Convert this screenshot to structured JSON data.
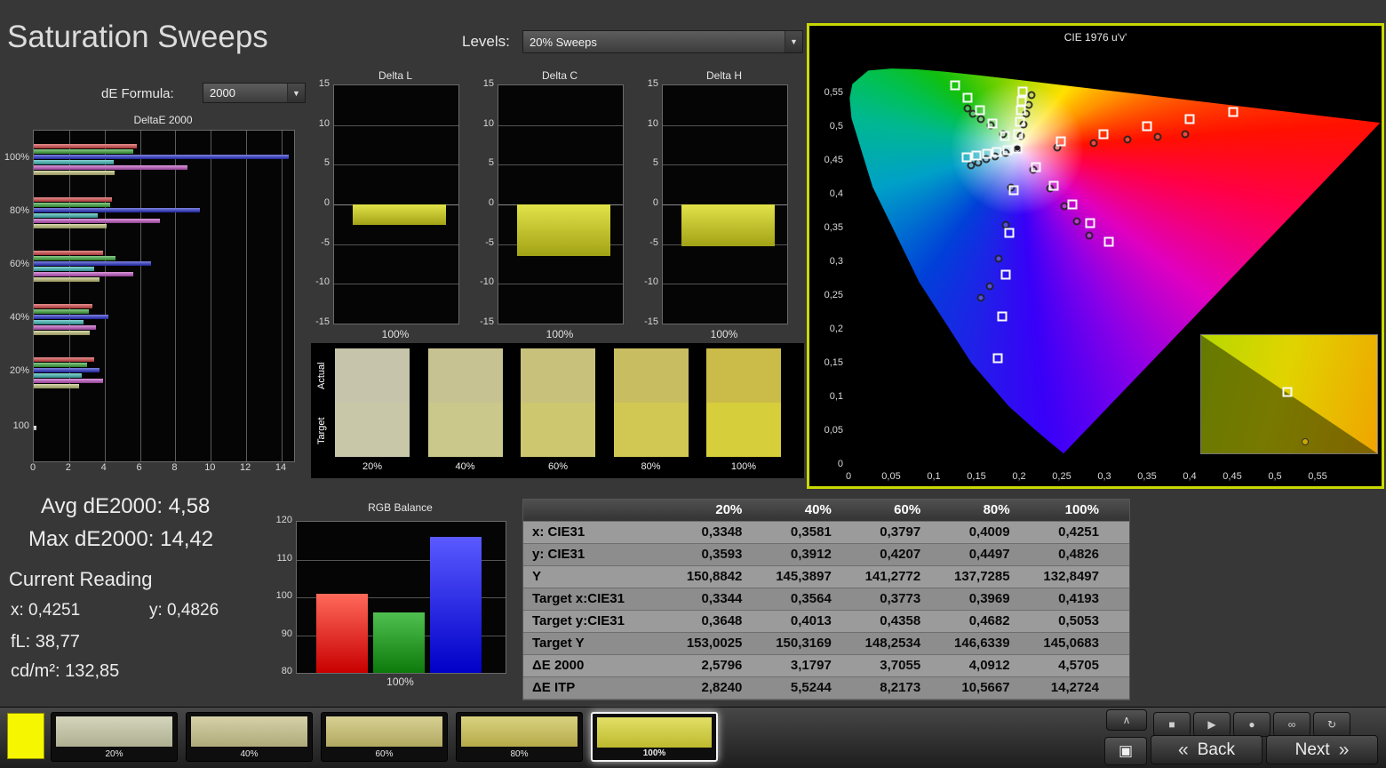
{
  "page": {
    "title": "Saturation Sweeps",
    "de_formula_label": "dE Formula:",
    "de_formula_value": "2000",
    "levels_label": "Levels:",
    "levels_value": "20% Sweeps"
  },
  "icons": {
    "dropdown_arrow": "▼"
  },
  "readings": {
    "avg": "Avg dE2000: 4,58",
    "max": "Max dE2000: 14,42",
    "current_title": "Current Reading",
    "x": "x: 0,4251",
    "y": "y: 0,4826",
    "fl": "fL: 38,77",
    "cdm2": "cd/m²: 132,85"
  },
  "table": {
    "columns": [
      "20%",
      "40%",
      "60%",
      "80%",
      "100%"
    ],
    "rows": [
      {
        "label": "x: CIE31",
        "values": [
          "0,3348",
          "0,3581",
          "0,3797",
          "0,4009",
          "0,4251"
        ]
      },
      {
        "label": "y: CIE31",
        "values": [
          "0,3593",
          "0,3912",
          "0,4207",
          "0,4497",
          "0,4826"
        ]
      },
      {
        "label": "Y",
        "values": [
          "150,8842",
          "145,3897",
          "141,2772",
          "137,7285",
          "132,8497"
        ]
      },
      {
        "label": "Target x:CIE31",
        "values": [
          "0,3344",
          "0,3564",
          "0,3773",
          "0,3969",
          "0,4193"
        ]
      },
      {
        "label": "Target y:CIE31",
        "values": [
          "0,3648",
          "0,4013",
          "0,4358",
          "0,4682",
          "0,5053"
        ]
      },
      {
        "label": "Target Y",
        "values": [
          "153,0025",
          "150,3169",
          "148,2534",
          "146,6339",
          "145,0683"
        ]
      },
      {
        "label": "ΔE 2000",
        "values": [
          "2,5796",
          "3,1797",
          "3,7055",
          "4,0912",
          "4,5705"
        ]
      },
      {
        "label": "ΔE ITP",
        "values": [
          "2,8240",
          "5,5244",
          "8,2173",
          "10,5667",
          "14,2724"
        ]
      }
    ]
  },
  "swatch_panel": {
    "row_labels": [
      "Actual",
      "Target"
    ],
    "levels": [
      "20%",
      "40%",
      "60%",
      "80%",
      "100%"
    ],
    "actual_colors": [
      "#c6c5ab",
      "#c7c292",
      "#c8c17b",
      "#c9bd62",
      "#cbbc4a"
    ],
    "target_colors": [
      "#c8c7a8",
      "#cac88b",
      "#cdc76f",
      "#d0c853",
      "#d6ce3a"
    ]
  },
  "toolbar": {
    "selected_color": "#f6f600",
    "levels": [
      {
        "label": "20%",
        "color": "#c7c7a6",
        "selected": false
      },
      {
        "label": "40%",
        "color": "#c8c28a",
        "selected": false
      },
      {
        "label": "60%",
        "color": "#cac06e",
        "selected": false
      },
      {
        "label": "80%",
        "color": "#cdc254",
        "selected": false
      },
      {
        "label": "100%",
        "color": "#d8d434",
        "selected": true
      }
    ],
    "controls": {
      "collapse_glyph": "∧",
      "buttons": [
        {
          "name": "stop",
          "glyph": "■"
        },
        {
          "name": "play",
          "glyph": "▶"
        },
        {
          "name": "record",
          "glyph": "●"
        },
        {
          "name": "continuous",
          "glyph": "∞"
        },
        {
          "name": "refresh",
          "glyph": "↻"
        }
      ],
      "stop_large_glyph": "▣",
      "back": {
        "chevron": "«",
        "label": "Back"
      },
      "next": {
        "label": "Next",
        "chevron": "»"
      }
    }
  },
  "chart_data": [
    {
      "id": "deltae_2000_bars",
      "type": "bar",
      "orientation": "horizontal",
      "title": "DeltaE 2000",
      "groups": [
        "100%",
        "80%",
        "60%",
        "40%",
        "20%",
        "100"
      ],
      "series": [
        {
          "name": "Red",
          "color": "#d84545",
          "values": [
            5.8,
            4.4,
            3.9,
            3.3,
            3.4,
            null
          ]
        },
        {
          "name": "Green",
          "color": "#3aa83a",
          "values": [
            5.6,
            4.3,
            4.6,
            3.1,
            3.0,
            null
          ]
        },
        {
          "name": "Blue",
          "color": "#2830cc",
          "values": [
            14.42,
            9.4,
            6.6,
            4.2,
            3.7,
            null
          ]
        },
        {
          "name": "Cyan",
          "color": "#3ab8b8",
          "values": [
            4.5,
            3.6,
            3.4,
            2.8,
            2.7,
            null
          ]
        },
        {
          "name": "Magenta",
          "color": "#c455c4",
          "values": [
            8.7,
            7.1,
            5.6,
            3.5,
            3.9,
            null
          ]
        },
        {
          "name": "Yellow",
          "color": "#c2c27a",
          "values": [
            4.57,
            4.09,
            3.71,
            3.18,
            2.58,
            null
          ]
        },
        {
          "name": "White",
          "color": "#e8e8e8",
          "values": [
            null,
            null,
            null,
            null,
            null,
            0.15
          ]
        }
      ],
      "xlim": [
        0,
        14.7
      ],
      "xticks": [
        0,
        2,
        4,
        6,
        8,
        10,
        12,
        14
      ]
    },
    {
      "id": "delta_l",
      "type": "bar",
      "title": "Delta L",
      "categories": [
        "100%"
      ],
      "values": [
        -2.6
      ],
      "ylim": [
        -15,
        15
      ],
      "yticks": [
        15,
        10,
        5,
        0,
        -5,
        -10,
        -15
      ],
      "bar_color": "#d6d62e"
    },
    {
      "id": "delta_c",
      "type": "bar",
      "title": "Delta C",
      "categories": [
        "100%"
      ],
      "values": [
        -6.5
      ],
      "ylim": [
        -15,
        15
      ],
      "yticks": [
        15,
        10,
        5,
        0,
        -5,
        -10,
        -15
      ],
      "bar_color": "#d6d62e"
    },
    {
      "id": "delta_h",
      "type": "bar",
      "title": "Delta H",
      "categories": [
        "100%"
      ],
      "values": [
        -5.3
      ],
      "ylim": [
        -15,
        15
      ],
      "yticks": [
        15,
        10,
        5,
        0,
        -5,
        -10,
        -15
      ],
      "bar_color": "#d6d62e"
    },
    {
      "id": "rgb_balance",
      "type": "bar",
      "title": "RGB Balance",
      "categories": [
        "Red",
        "Green",
        "Blue"
      ],
      "values": [
        101,
        96,
        116
      ],
      "colors": [
        "#e00000",
        "#18a018",
        "#2020e8"
      ],
      "ylim": [
        80,
        120
      ],
      "yticks": [
        120,
        110,
        100,
        90,
        80
      ],
      "xlabel": "100%"
    },
    {
      "id": "cie_1976_uv",
      "type": "scatter",
      "title": "CIE 1976 u'v'",
      "xlim": [
        0,
        0.6
      ],
      "ylim": [
        0,
        0.6
      ],
      "ticks": [
        0,
        0.05,
        0.1,
        0.15,
        0.2,
        0.25,
        0.3,
        0.35,
        0.4,
        0.45,
        0.5,
        0.55
      ],
      "white_point": [
        0.1978,
        0.4683
      ],
      "locus": [
        [
          0.6234,
          0.5065
        ],
        [
          0.5203,
          0.5219
        ],
        [
          0.4035,
          0.5393
        ],
        [
          0.3315,
          0.5501
        ],
        [
          0.2623,
          0.5604
        ],
        [
          0.2026,
          0.5693
        ],
        [
          0.1531,
          0.5766
        ],
        [
          0.1127,
          0.5821
        ],
        [
          0.0792,
          0.5856
        ],
        [
          0.0501,
          0.5867
        ],
        [
          0.0231,
          0.5837
        ],
        [
          0.0046,
          0.5638
        ],
        [
          0.0014,
          0.5432
        ],
        [
          0.0035,
          0.5131
        ],
        [
          0.0282,
          0.4117
        ],
        [
          0.0828,
          0.2708
        ],
        [
          0.1441,
          0.151
        ],
        [
          0.1877,
          0.0871
        ],
        [
          0.2161,
          0.0549
        ],
        [
          0.2347,
          0.035
        ],
        [
          0.2522,
          0.0169
        ]
      ],
      "targets": {
        "red": [
          [
            0.2486,
            0.4789
          ],
          [
            0.2991,
            0.4899
          ],
          [
            0.3496,
            0.5009
          ],
          [
            0.4001,
            0.5119
          ],
          [
            0.4507,
            0.5229
          ]
        ],
        "green": [
          [
            0.1834,
            0.4869
          ],
          [
            0.1688,
            0.5058
          ],
          [
            0.1542,
            0.5247
          ],
          [
            0.1396,
            0.5436
          ],
          [
            0.125,
            0.5625
          ]
        ],
        "blue": [
          [
            0.1935,
            0.406
          ],
          [
            0.189,
            0.344
          ],
          [
            0.1845,
            0.282
          ],
          [
            0.18,
            0.22
          ],
          [
            0.1754,
            0.1579
          ]
        ],
        "cyan": [
          [
            0.186,
            0.4654
          ],
          [
            0.174,
            0.4628
          ],
          [
            0.162,
            0.4603
          ],
          [
            0.15,
            0.4578
          ],
          [
            0.1383,
            0.4554
          ]
        ],
        "magenta": [
          [
            0.2194,
            0.4404
          ],
          [
            0.2408,
            0.4127
          ],
          [
            0.2622,
            0.3851
          ],
          [
            0.2836,
            0.3574
          ],
          [
            0.305,
            0.3298
          ]
        ],
        "yellow": [
          [
            0.1994,
            0.4894
          ],
          [
            0.2007,
            0.5085
          ],
          [
            0.2019,
            0.5247
          ],
          [
            0.2029,
            0.5385
          ],
          [
            0.2039,
            0.5529
          ]
        ],
        "white": [
          [
            0.1978,
            0.4683
          ]
        ]
      },
      "measurements": {
        "red": [
          [
            0.245,
            0.47
          ],
          [
            0.288,
            0.476
          ],
          [
            0.327,
            0.481
          ],
          [
            0.362,
            0.486
          ],
          [
            0.395,
            0.49
          ]
        ],
        "green": [
          [
            0.181,
            0.49
          ],
          [
            0.167,
            0.503
          ],
          [
            0.155,
            0.512
          ],
          [
            0.146,
            0.52
          ],
          [
            0.14,
            0.527
          ]
        ],
        "blue": [
          [
            0.191,
            0.41
          ],
          [
            0.184,
            0.355
          ],
          [
            0.176,
            0.305
          ],
          [
            0.166,
            0.264
          ],
          [
            0.155,
            0.247
          ]
        ],
        "cyan": [
          [
            0.184,
            0.462
          ],
          [
            0.172,
            0.457
          ],
          [
            0.161,
            0.452
          ],
          [
            0.152,
            0.448
          ],
          [
            0.144,
            0.444
          ]
        ],
        "magenta": [
          [
            0.217,
            0.437
          ],
          [
            0.236,
            0.409
          ],
          [
            0.253,
            0.383
          ],
          [
            0.268,
            0.36
          ],
          [
            0.282,
            0.34
          ]
        ],
        "yellow": [
          [
            0.2016,
            0.4868
          ],
          [
            0.2053,
            0.5045
          ],
          [
            0.2084,
            0.5194
          ],
          [
            0.2112,
            0.5329
          ],
          [
            0.2141,
            0.5469
          ]
        ],
        "white": [
          [
            0.1982,
            0.4675
          ]
        ]
      }
    }
  ]
}
